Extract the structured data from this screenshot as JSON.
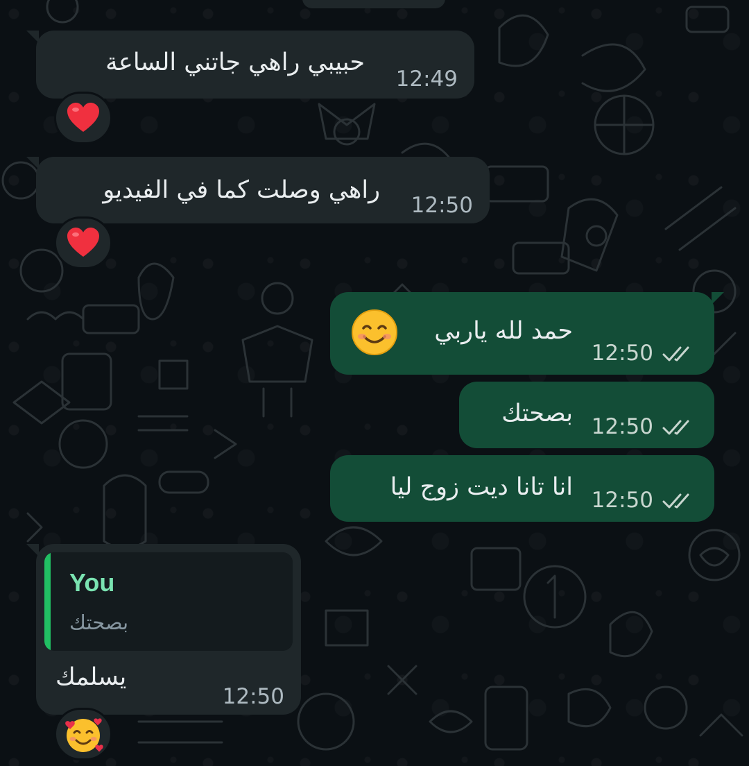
{
  "colors": {
    "background": "#0b1014",
    "incoming_bubble": "#1f272a",
    "outgoing_bubble": "#134d37",
    "quote_accent": "#21c063",
    "quote_author": "#7ae3b1"
  },
  "messages": [
    {
      "direction": "incoming",
      "text": "حبيبي راهي جاتني الساعة",
      "time": "12:49",
      "reaction": "heart-icon"
    },
    {
      "direction": "incoming",
      "text": "راهي وصلت كما في الفيديو",
      "time": "12:50",
      "reaction": "heart-icon"
    },
    {
      "direction": "outgoing",
      "text": "حمد لله ياربي",
      "emoji": "smiling-face-icon",
      "time": "12:50",
      "status": "read-double-check-icon"
    },
    {
      "direction": "outgoing",
      "text": "بصحتك",
      "time": "12:50",
      "status": "read-double-check-icon"
    },
    {
      "direction": "outgoing",
      "text": "انا تانا ديت زوج ليا",
      "time": "12:50",
      "status": "read-double-check-icon"
    },
    {
      "direction": "incoming",
      "quote": {
        "author": "You",
        "text": "بصحتك"
      },
      "text": "يسلمك",
      "time": "12:50",
      "reaction": "smiling-face-with-hearts-icon"
    }
  ]
}
